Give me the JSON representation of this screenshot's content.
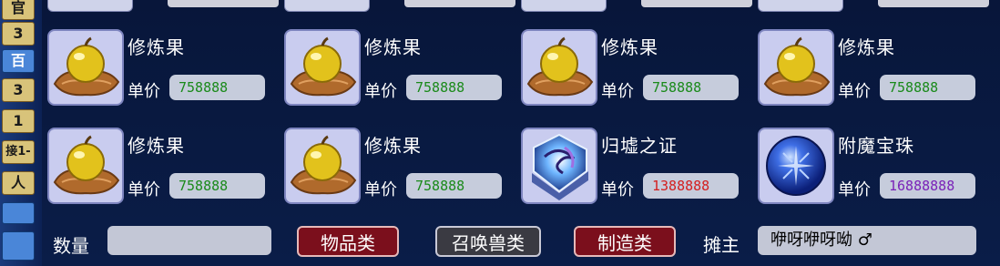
{
  "left_strip": {
    "cells": [
      "官",
      "3",
      "百",
      "3",
      "1",
      "接1-",
      "人"
    ]
  },
  "items": [
    {
      "name": "修炼果",
      "price_label": "单价",
      "price": "758888",
      "icon": "fruit-icon",
      "price_color": "#1a8a1a"
    },
    {
      "name": "修炼果",
      "price_label": "单价",
      "price": "758888",
      "icon": "fruit-icon",
      "price_color": "#1a8a1a"
    },
    {
      "name": "修炼果",
      "price_label": "单价",
      "price": "758888",
      "icon": "fruit-icon",
      "price_color": "#1a8a1a"
    },
    {
      "name": "修炼果",
      "price_label": "单价",
      "price": "758888",
      "icon": "fruit-icon",
      "price_color": "#1a8a1a"
    },
    {
      "name": "修炼果",
      "price_label": "单价",
      "price": "758888",
      "icon": "fruit-icon",
      "price_color": "#1a8a1a"
    },
    {
      "name": "修炼果",
      "price_label": "单价",
      "price": "758888",
      "icon": "fruit-icon",
      "price_color": "#1a8a1a"
    },
    {
      "name": "归墟之证",
      "price_label": "单价",
      "price": "1388888",
      "icon": "guixu-token-icon",
      "price_color": "#d41f1f"
    },
    {
      "name": "附魔宝珠",
      "price_label": "单价",
      "price": "16888888",
      "icon": "enchant-orb-icon",
      "price_color": "#7a22b8"
    }
  ],
  "bottom": {
    "qty_label": "数量",
    "qty_value": "",
    "buttons": [
      "物品类",
      "召唤兽类",
      "制造类"
    ],
    "seller_label": "摊主",
    "seller_value": "咿呀咿呀呦 ♂"
  },
  "colors": {
    "panel_bg": "#0a1d48",
    "button_red": "#7b0f1c",
    "button_gray": "#3a3a42"
  }
}
